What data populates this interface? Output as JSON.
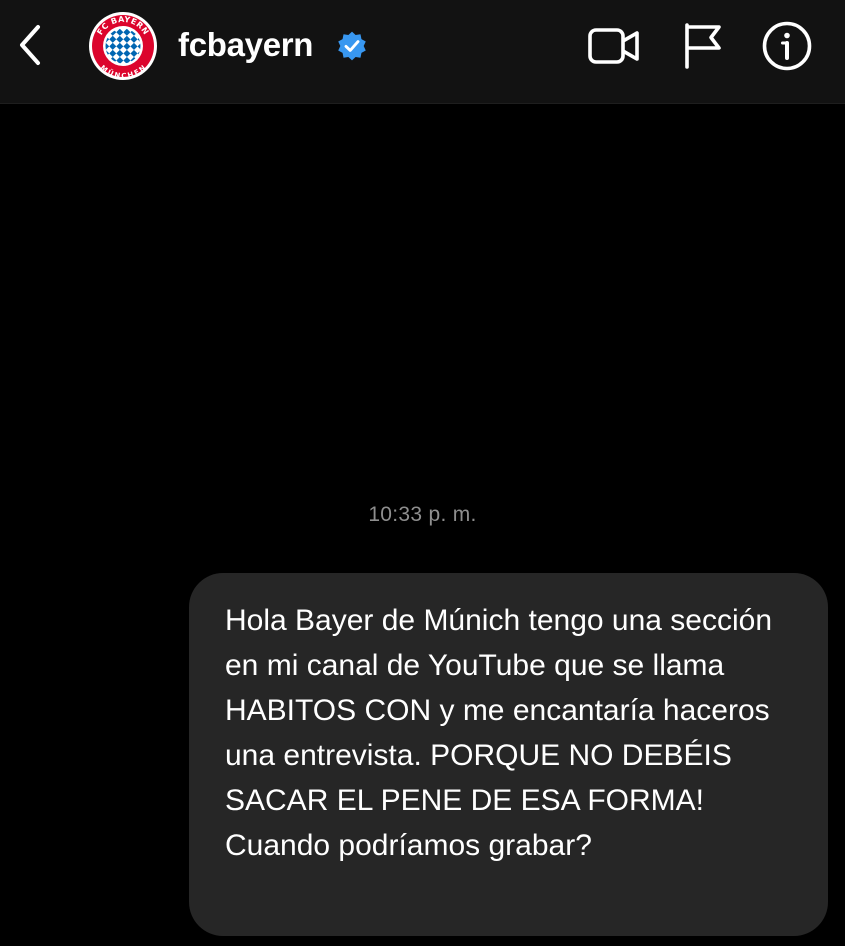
{
  "header": {
    "username": "fcbayern",
    "verified": true,
    "avatar": {
      "ring_text_top": "FC BAYERN",
      "ring_text_bottom": "MÜNCHEN"
    },
    "icons": {
      "back": "chevron-left-icon",
      "video": "video-camera-icon",
      "flag": "flag-icon",
      "info": "info-icon"
    }
  },
  "conversation": {
    "timestamp": "10:33 p. m.",
    "messages": [
      {
        "sender": "me",
        "text": "Hola Bayer de Múnich tengo una sección en mi canal de YouTube que se llama HABITOS CON y me encantaría haceros una entrevista. PORQUE NO DEBÉIS SACAR EL PENE DE ESA FORMA! Cuando podríamos grabar?"
      }
    ]
  },
  "colors": {
    "background": "#000000",
    "header_background": "#121212",
    "bubble_background": "#262626",
    "verified_blue": "#3897f0",
    "timestamp_gray": "#8e8e8e",
    "bayern_red": "#dc052d",
    "bayern_blue": "#0066b2"
  }
}
